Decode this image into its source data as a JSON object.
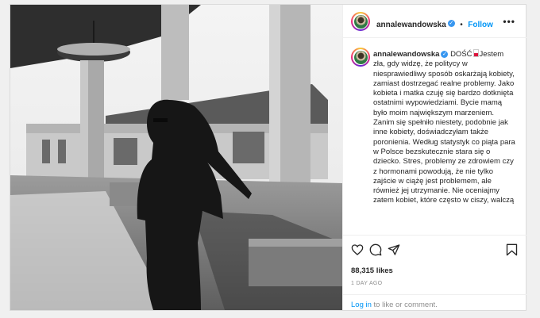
{
  "post": {
    "username": "annalewandowska",
    "follow_label": "Follow",
    "follow_separator": "•",
    "more_icon": "more-horizontal-icon",
    "verified_icon": "verified-badge-icon",
    "caption_prefix": "DOŚĆ",
    "caption_text": "Jestem zła, gdy widzę, że politycy w niesprawiedliwy sposób oskarżają kobiety, zamiast dostrzegać realne problemy. Jako kobieta i matka czuję się bardzo dotknięta ostatnimi wypowiedziami. Bycie mamą było moim największym marzeniem. Zanim się spełniło niestety, podobnie jak inne kobiety, doświadczyłam także poronienia. Według statystyk co piąta para w Polsce bezskutecznie stara się o dziecko. Stres, problemy ze zdrowiem czy z hormonami powodują, że nie tylko zajście w ciążę jest problemem, ale również jej utrzymanie. Nie oceniajmy zatem kobiet, które często w ciszy, walczą",
    "likes": "88,315 likes",
    "time_ago": "1 DAY AGO",
    "login_link": "Log in",
    "login_suffix": " to like or comment.",
    "icons": {
      "like": "heart-icon",
      "comment": "comment-icon",
      "share": "send-icon",
      "save": "bookmark-icon"
    },
    "colors": {
      "accent": "#0095f6",
      "verified": "#3897f0"
    }
  }
}
